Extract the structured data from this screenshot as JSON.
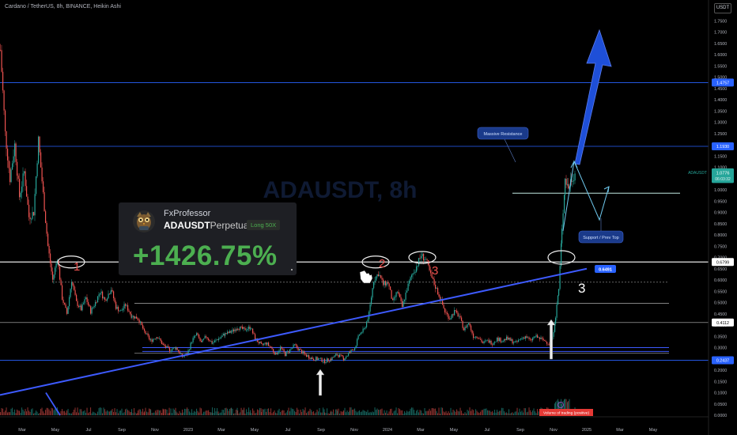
{
  "header": {
    "title": "Cardano / TetherUS, 8h, BINANCE, Heikin Ashi",
    "currency": "USDT"
  },
  "chart_data": {
    "type": "candlestick",
    "symbol": "ADAUSDT",
    "yaxis": {
      "min": 0.0,
      "max": 1.8,
      "ticks": [
        "1.7500",
        "1.7000",
        "1.6500",
        "1.6000",
        "1.5500",
        "1.5000",
        "1.4500",
        "1.4000",
        "1.3500",
        "1.3000",
        "1.2500",
        "1.2000",
        "1.1500",
        "1.1000",
        "1.0500",
        "1.0000",
        "0.9500",
        "0.9000",
        "0.8500",
        "0.8000",
        "0.7500",
        "0.7000",
        "0.6500",
        "0.6000",
        "0.5500",
        "0.5000",
        "0.4500",
        "0.4000",
        "0.3500",
        "0.3000",
        "0.2500",
        "0.2000",
        "0.1500",
        "0.1000",
        "0.0500",
        "0.0000"
      ]
    },
    "xaxis": {
      "labels": [
        "Mar",
        "May",
        "Jul",
        "Sep",
        "Nov",
        "2023",
        "Mar",
        "May",
        "Jul",
        "Sep",
        "Nov",
        "2024",
        "Mar",
        "May",
        "Jul",
        "Sep",
        "Nov",
        "2025",
        "Mar",
        "May"
      ]
    },
    "price_path": [
      [
        0,
        1.62
      ],
      [
        6,
        1.25
      ],
      [
        12,
        1.05
      ],
      [
        18,
        1.2
      ],
      [
        24,
        0.97
      ],
      [
        30,
        1.08
      ],
      [
        36,
        0.88
      ],
      [
        42,
        0.9
      ],
      [
        48,
        1.22
      ],
      [
        54,
        0.98
      ],
      [
        60,
        0.75
      ],
      [
        66,
        0.6
      ],
      [
        72,
        0.7
      ],
      [
        78,
        0.52
      ],
      [
        84,
        0.45
      ],
      [
        90,
        0.6
      ],
      [
        96,
        0.5
      ],
      [
        102,
        0.47
      ],
      [
        108,
        0.52
      ],
      [
        114,
        0.46
      ],
      [
        120,
        0.5
      ],
      [
        126,
        0.55
      ],
      [
        132,
        0.51
      ],
      [
        140,
        0.56
      ],
      [
        146,
        0.48
      ],
      [
        152,
        0.46
      ],
      [
        158,
        0.49
      ],
      [
        166,
        0.44
      ],
      [
        174,
        0.43
      ],
      [
        182,
        0.37
      ],
      [
        190,
        0.33
      ],
      [
        198,
        0.35
      ],
      [
        206,
        0.31
      ],
      [
        214,
        0.29
      ],
      [
        222,
        0.3
      ],
      [
        230,
        0.26
      ],
      [
        236,
        0.27
      ],
      [
        242,
        0.33
      ],
      [
        248,
        0.36
      ],
      [
        254,
        0.32
      ],
      [
        260,
        0.35
      ],
      [
        268,
        0.32
      ],
      [
        276,
        0.34
      ],
      [
        284,
        0.36
      ],
      [
        292,
        0.37
      ],
      [
        300,
        0.39
      ],
      [
        308,
        0.38
      ],
      [
        316,
        0.39
      ],
      [
        322,
        0.34
      ],
      [
        330,
        0.31
      ],
      [
        336,
        0.32
      ],
      [
        342,
        0.3
      ],
      [
        348,
        0.27
      ],
      [
        354,
        0.3
      ],
      [
        360,
        0.27
      ],
      [
        366,
        0.29
      ],
      [
        372,
        0.31
      ],
      [
        378,
        0.29
      ],
      [
        384,
        0.27
      ],
      [
        390,
        0.26
      ],
      [
        396,
        0.25
      ],
      [
        402,
        0.25
      ],
      [
        410,
        0.24
      ],
      [
        418,
        0.25
      ],
      [
        426,
        0.27
      ],
      [
        434,
        0.25
      ],
      [
        442,
        0.28
      ],
      [
        448,
        0.3
      ],
      [
        454,
        0.36
      ],
      [
        460,
        0.38
      ],
      [
        466,
        0.45
      ],
      [
        472,
        0.6
      ],
      [
        478,
        0.63
      ],
      [
        484,
        0.58
      ],
      [
        490,
        0.59
      ],
      [
        496,
        0.5
      ],
      [
        502,
        0.55
      ],
      [
        508,
        0.48
      ],
      [
        514,
        0.56
      ],
      [
        520,
        0.62
      ],
      [
        526,
        0.66
      ],
      [
        532,
        0.71
      ],
      [
        538,
        0.69
      ],
      [
        544,
        0.62
      ],
      [
        550,
        0.57
      ],
      [
        556,
        0.52
      ],
      [
        562,
        0.46
      ],
      [
        568,
        0.43
      ],
      [
        574,
        0.46
      ],
      [
        580,
        0.44
      ],
      [
        586,
        0.38
      ],
      [
        592,
        0.41
      ],
      [
        598,
        0.35
      ],
      [
        604,
        0.35
      ],
      [
        610,
        0.32
      ],
      [
        616,
        0.33
      ],
      [
        622,
        0.32
      ],
      [
        628,
        0.34
      ],
      [
        634,
        0.33
      ],
      [
        640,
        0.34
      ],
      [
        646,
        0.33
      ],
      [
        652,
        0.32
      ],
      [
        658,
        0.34
      ],
      [
        664,
        0.35
      ],
      [
        670,
        0.33
      ],
      [
        676,
        0.35
      ],
      [
        682,
        0.34
      ],
      [
        688,
        0.33
      ],
      [
        694,
        0.32
      ],
      [
        698,
        0.34
      ],
      [
        702,
        0.44
      ],
      [
        706,
        0.56
      ],
      [
        710,
        0.82
      ],
      [
        714,
        1.05
      ],
      [
        718,
        1.01
      ],
      [
        722,
        1.05
      ],
      [
        728,
        1.08
      ]
    ],
    "horizontal_levels": [
      1.4757,
      1.193,
      0.6799,
      0.4112,
      0.2437
    ],
    "price_labels": [
      {
        "value": "1.4757",
        "color": "#2962ff"
      },
      {
        "value": "1.1930",
        "color": "#2962ff"
      },
      {
        "value": "1.0776",
        "color": "#26a69a"
      },
      {
        "value": "0.6799",
        "color": "#ffffff"
      },
      {
        "value": "0.4112",
        "color": "#ffffff"
      },
      {
        "value": "0.2437",
        "color": "#2962ff"
      }
    ],
    "last_price": {
      "label": "ADAUSDT",
      "value": "1.0776",
      "timer": "06:03:32"
    },
    "trendline_label": "0.6491",
    "watermark": "ADAUSDT, 8h",
    "annotations": {
      "touch_labels": [
        "1",
        "2",
        "3",
        "3"
      ],
      "bubble_resistance": "Massive Resistance",
      "bubble_support": "Support / Prev Top",
      "volume_banner": "Volume of trading (positive)"
    },
    "colors": {
      "up": "#26a69a",
      "down": "#ef5350",
      "trend": "#3d5afe",
      "target": "#1e4fd8"
    }
  },
  "card": {
    "username": "FxProfessor",
    "symbol": "ADAUSDT",
    "contract": "Perpetual",
    "position": "Long 50X",
    "pnl": "+1426.75%"
  }
}
